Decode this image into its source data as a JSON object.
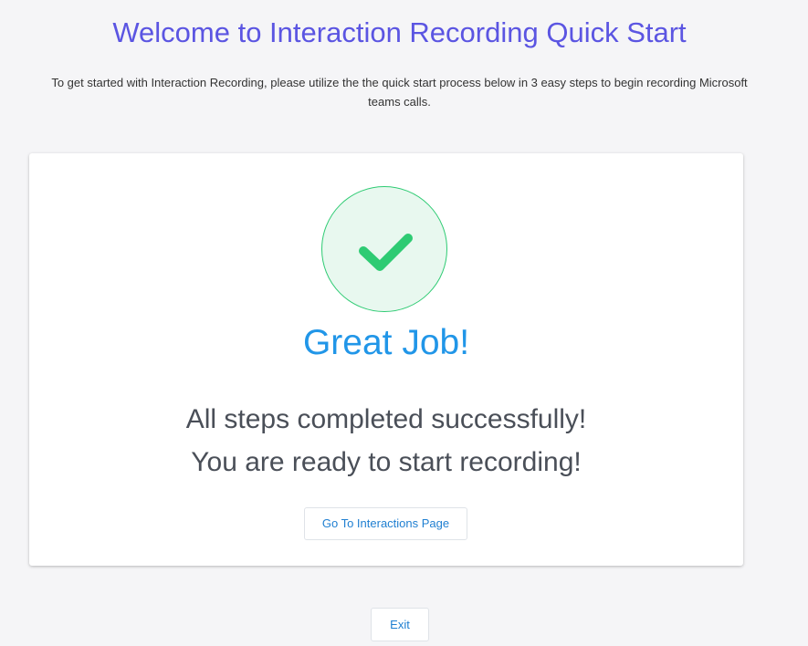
{
  "header": {
    "title": "Welcome to Interaction Recording Quick Start",
    "intro": "To get started with Interaction Recording, please utilize the the quick start process below in 3 easy steps to begin recording Microsoft teams calls."
  },
  "card": {
    "icon": "checkmark-icon",
    "heading": "Great Job!",
    "line1": "All steps completed successfully!",
    "line2": "You are ready to start recording!",
    "button_label": "Go To Interactions Page"
  },
  "footer": {
    "exit_label": "Exit"
  },
  "colors": {
    "title": "#5b55e2",
    "accent": "#2196e8",
    "success": "#2ecb73",
    "success_bg": "#e8f8ef",
    "background": "#f5f5f7"
  }
}
